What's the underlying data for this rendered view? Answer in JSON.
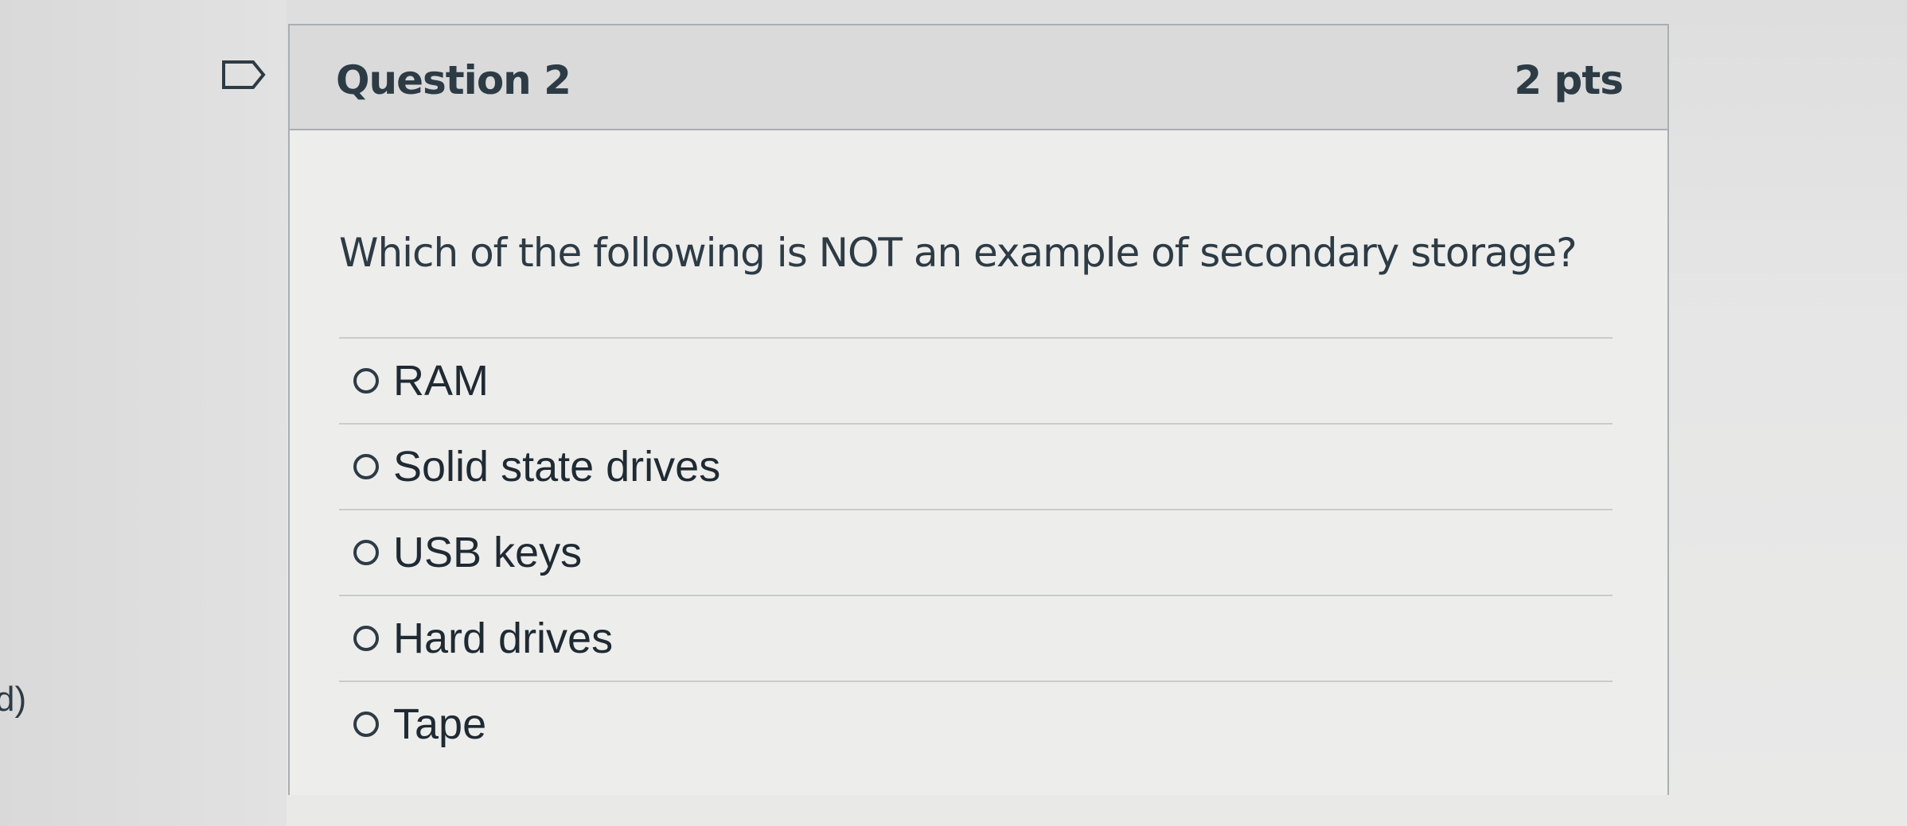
{
  "side_fragment": "d)",
  "question": {
    "title": "Question 2",
    "points": "2 pts",
    "text": "Which of the following is NOT an example of secondary storage?",
    "answers": [
      {
        "label": "RAM"
      },
      {
        "label": "Solid state drives"
      },
      {
        "label": "USB keys"
      },
      {
        "label": "Hard drives"
      },
      {
        "label": "Tape"
      }
    ]
  },
  "icons": {
    "flag": "flag-question-icon"
  }
}
